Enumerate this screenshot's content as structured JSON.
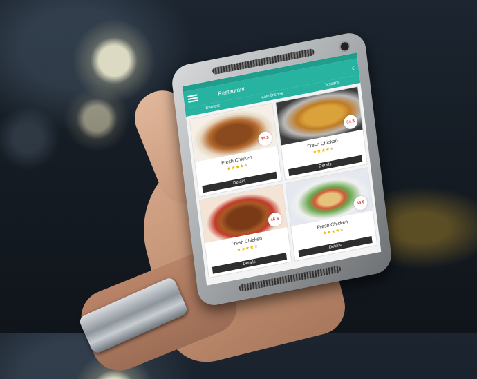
{
  "app": {
    "title": "Restaurant",
    "tabs": [
      "Starters",
      "Main Dishes",
      "Desserts"
    ]
  },
  "cards": [
    {
      "name": "Fresh Chicken",
      "price": "45.$",
      "rating": 4,
      "button": "Details",
      "photo": "chicken"
    },
    {
      "name": "Fresh Chicken",
      "price": "34.$",
      "rating": 4,
      "button": "Details",
      "photo": "rice"
    },
    {
      "name": "Fresh Chicken",
      "price": "45.$",
      "rating": 4,
      "button": "Details",
      "photo": "roast"
    },
    {
      "name": "Fresh Chicken",
      "price": "36.$",
      "rating": 4,
      "button": "Details",
      "photo": "salad"
    }
  ],
  "colors": {
    "accent": "#27b3a0",
    "button": "#2e2e2e",
    "star": "#f2b600"
  }
}
